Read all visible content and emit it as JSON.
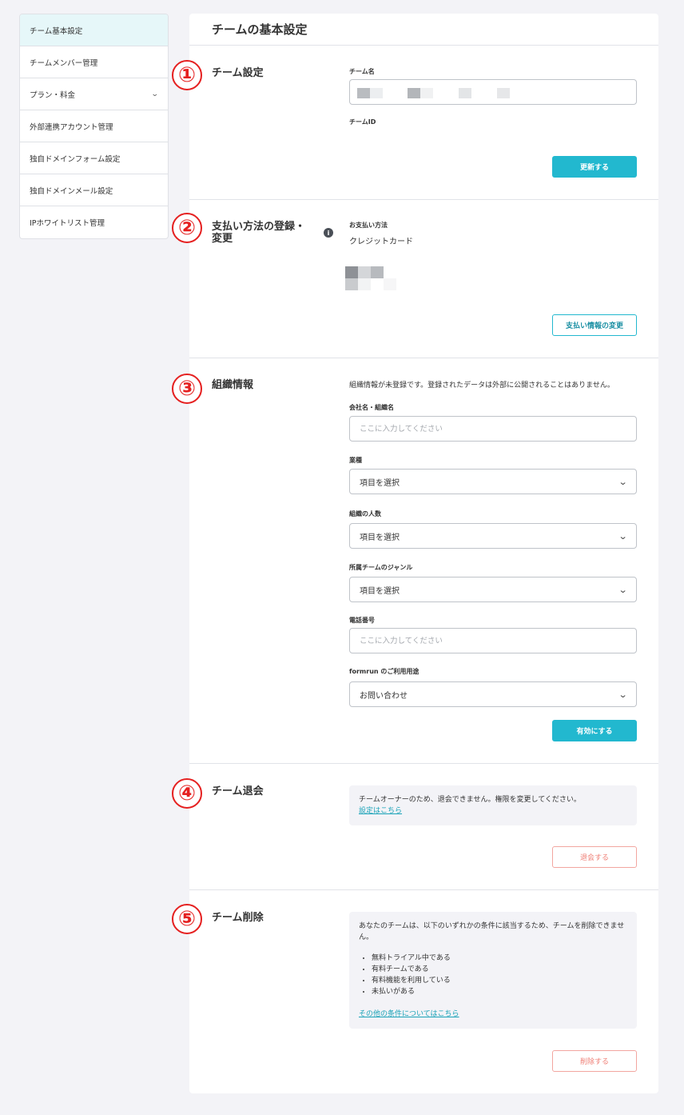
{
  "sidebar": {
    "items": [
      {
        "label": "チーム基本設定"
      },
      {
        "label": "チームメンバー管理"
      },
      {
        "label": "プラン・料金"
      },
      {
        "label": "外部連携アカウント管理"
      },
      {
        "label": "独自ドメインフォーム設定"
      },
      {
        "label": "独自ドメインメール設定"
      },
      {
        "label": "IPホワイトリスト管理"
      }
    ]
  },
  "page": {
    "title": "チームの基本設定"
  },
  "badges": [
    "①",
    "②",
    "③",
    "④",
    "⑤"
  ],
  "team_settings": {
    "title": "チーム設定",
    "name_label": "チーム名",
    "id_label": "チームID",
    "update_button": "更新する"
  },
  "payment": {
    "title": "支払い方法の登録・変更",
    "info_icon": "i",
    "method_label": "お支払い方法",
    "method_value": "クレジットカード",
    "change_button": "支払い情報の変更"
  },
  "organization": {
    "title": "組織情報",
    "notice": "組織情報が未登録です。登録されたデータは外部に公開されることはありません。",
    "company_label": "会社名・組織名",
    "company_placeholder": "ここに入力してください",
    "industry_label": "業種",
    "industry_value": "項目を選択",
    "size_label": "組織の人数",
    "size_value": "項目を選択",
    "genre_label": "所属チームのジャンル",
    "genre_value": "項目を選択",
    "phone_label": "電話番号",
    "phone_placeholder": "ここに入力してください",
    "usage_label": "formrun のご利用用途",
    "usage_value": "お問い合わせ",
    "enable_button": "有効にする"
  },
  "leave": {
    "title": "チーム退会",
    "notice": "チームオーナーのため、退会できません。権限を変更してください。",
    "link": "設定はこちら",
    "button": "退会する"
  },
  "delete": {
    "title": "チーム削除",
    "notice": "あなたのチームは、以下のいずれかの条件に該当するため、チームを削除できません。",
    "conditions": [
      "無料トライアル中である",
      "有料チームである",
      "有料機能を利用している",
      "未払いがある"
    ],
    "link": "その他の条件についてはこちら",
    "button": "削除する"
  },
  "colors": {
    "accent": "#22b8cf",
    "danger": "#ef7d74",
    "badge": "#e52020"
  }
}
